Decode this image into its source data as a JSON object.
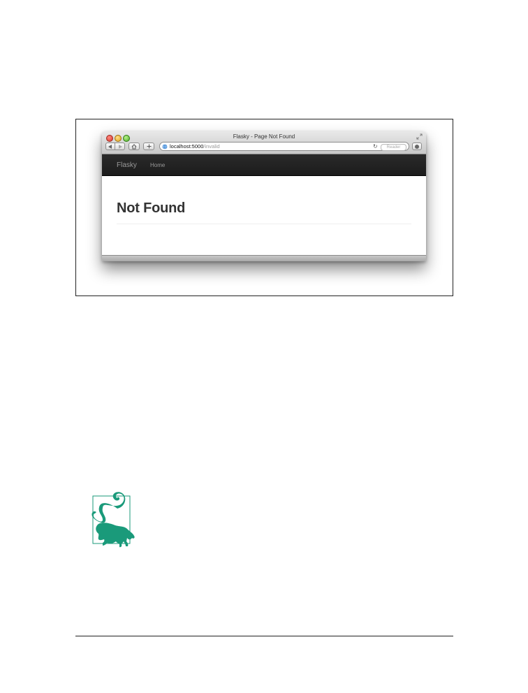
{
  "browser": {
    "window_title": "Flasky - Page Not Found",
    "url_host": "localhost:5000",
    "url_path": "/invalid",
    "reader_label": "Reader",
    "reload_glyph": "C"
  },
  "app": {
    "brand": "Flasky",
    "nav_items": [
      {
        "label": "Home"
      }
    ],
    "heading": "Not Found"
  },
  "icons": {
    "back": "triangle-left-icon",
    "forward": "triangle-right-icon",
    "home": "home-icon",
    "add_bookmark": "plus-icon",
    "globe": "globe-icon",
    "reload": "reload-icon",
    "downloads": "downloads-icon",
    "note_animal": "lemur-note-icon"
  },
  "colors": {
    "navbar": "#222222",
    "note_icon": "#1a9a7a"
  }
}
